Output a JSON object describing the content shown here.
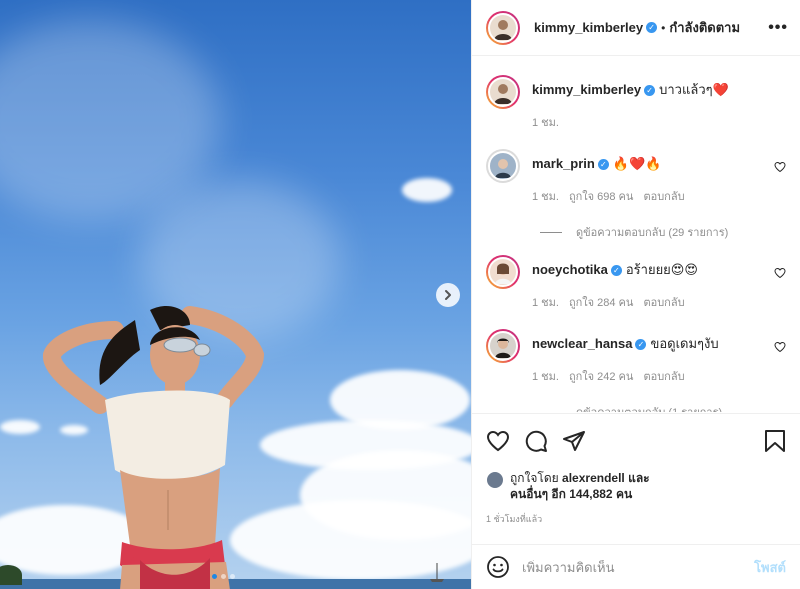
{
  "header": {
    "username": "kimmy_kimberley",
    "separator": "•",
    "follow_status": "กำลังติดตาม",
    "more": "•••"
  },
  "caption": {
    "username": "kimmy_kimberley",
    "text": "บาวแล้วๆ❤️",
    "time": "1 ชม."
  },
  "comments": [
    {
      "username": "mark_prin",
      "verified": true,
      "text": "🔥❤️🔥",
      "time": "1 ชม.",
      "likes": "ถูกใจ 698 คน",
      "reply": "ตอบกลับ",
      "view_replies": "ดูข้อความตอบกลับ (29 รายการ)"
    },
    {
      "username": "noeychotika",
      "verified": true,
      "text": "อร้ายยย😍😍",
      "time": "1 ชม.",
      "likes": "ถูกใจ 284 คน",
      "reply": "ตอบกลับ"
    },
    {
      "username": "newclear_hansa",
      "verified": true,
      "text": "ขอดูเดมๆงับ",
      "time": "1 ชม.",
      "likes": "ถูกใจ 242 คน",
      "reply": "ตอบกลับ",
      "view_replies": "ดูข้อความตอบกลับ (1 รายการ)"
    }
  ],
  "likes_summary": {
    "prefix": "ถูกใจโดย",
    "user": "alexrendell",
    "and": "และ",
    "others": "คนอื่นๆ อีก 144,882 คน"
  },
  "post_time": "1 ชั่วโมงที่แล้ว",
  "add_comment": {
    "placeholder": "เพิ่มความคิดเห็น",
    "post_label": "โพสต์"
  },
  "colors": {
    "verified": "#3897f0",
    "post_disabled": "#b2dffc",
    "muted": "#8e8e8e"
  },
  "icons": [
    "next-arrow-icon",
    "heart-icon",
    "comment-icon",
    "share-icon",
    "bookmark-icon",
    "emoji-icon",
    "verified-badge-icon",
    "more-options-icon"
  ]
}
